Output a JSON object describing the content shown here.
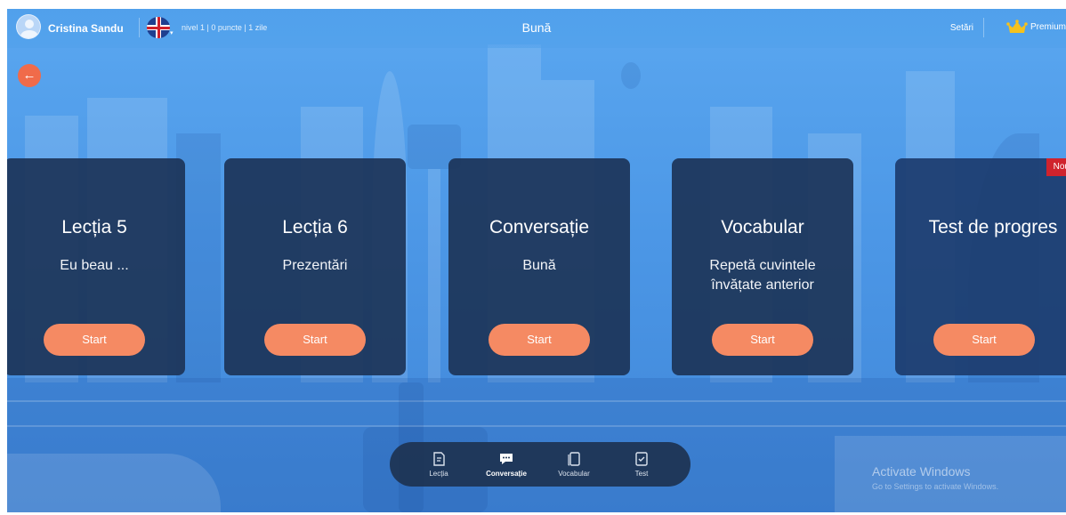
{
  "header": {
    "user_name": "Cristina Sandu",
    "stats": "nivel 1  |  0 puncte  |  1 zile",
    "title": "Bună",
    "settings_label": "Setări",
    "premium_label": "Premium"
  },
  "cards": [
    {
      "title": "Lecția 5",
      "subtitle": "Eu beau ...",
      "button": "Start"
    },
    {
      "title": "Lecția 6",
      "subtitle": "Prezentări",
      "button": "Start"
    },
    {
      "title": "Conversație",
      "subtitle": "Bună",
      "button": "Start"
    },
    {
      "title": "Vocabular",
      "subtitle": "Repetă cuvintele învățate anterior",
      "button": "Start"
    },
    {
      "title": "Test de progres",
      "subtitle": "",
      "button": "Start",
      "badge": "Nou"
    }
  ],
  "bottom_nav": {
    "items": [
      {
        "label": "Lecția",
        "icon": "lesson-icon"
      },
      {
        "label": "Conversație",
        "icon": "chat-icon",
        "active": true
      },
      {
        "label": "Vocabular",
        "icon": "cards-icon"
      },
      {
        "label": "Test",
        "icon": "test-icon"
      }
    ]
  },
  "watermark": {
    "title": "Activate Windows",
    "subtitle": "Go to Settings to activate Windows."
  },
  "colors": {
    "accent": "#f58a63",
    "card_bg": "#1c3458",
    "background": "#4c97e6",
    "badge": "#d0232d"
  }
}
